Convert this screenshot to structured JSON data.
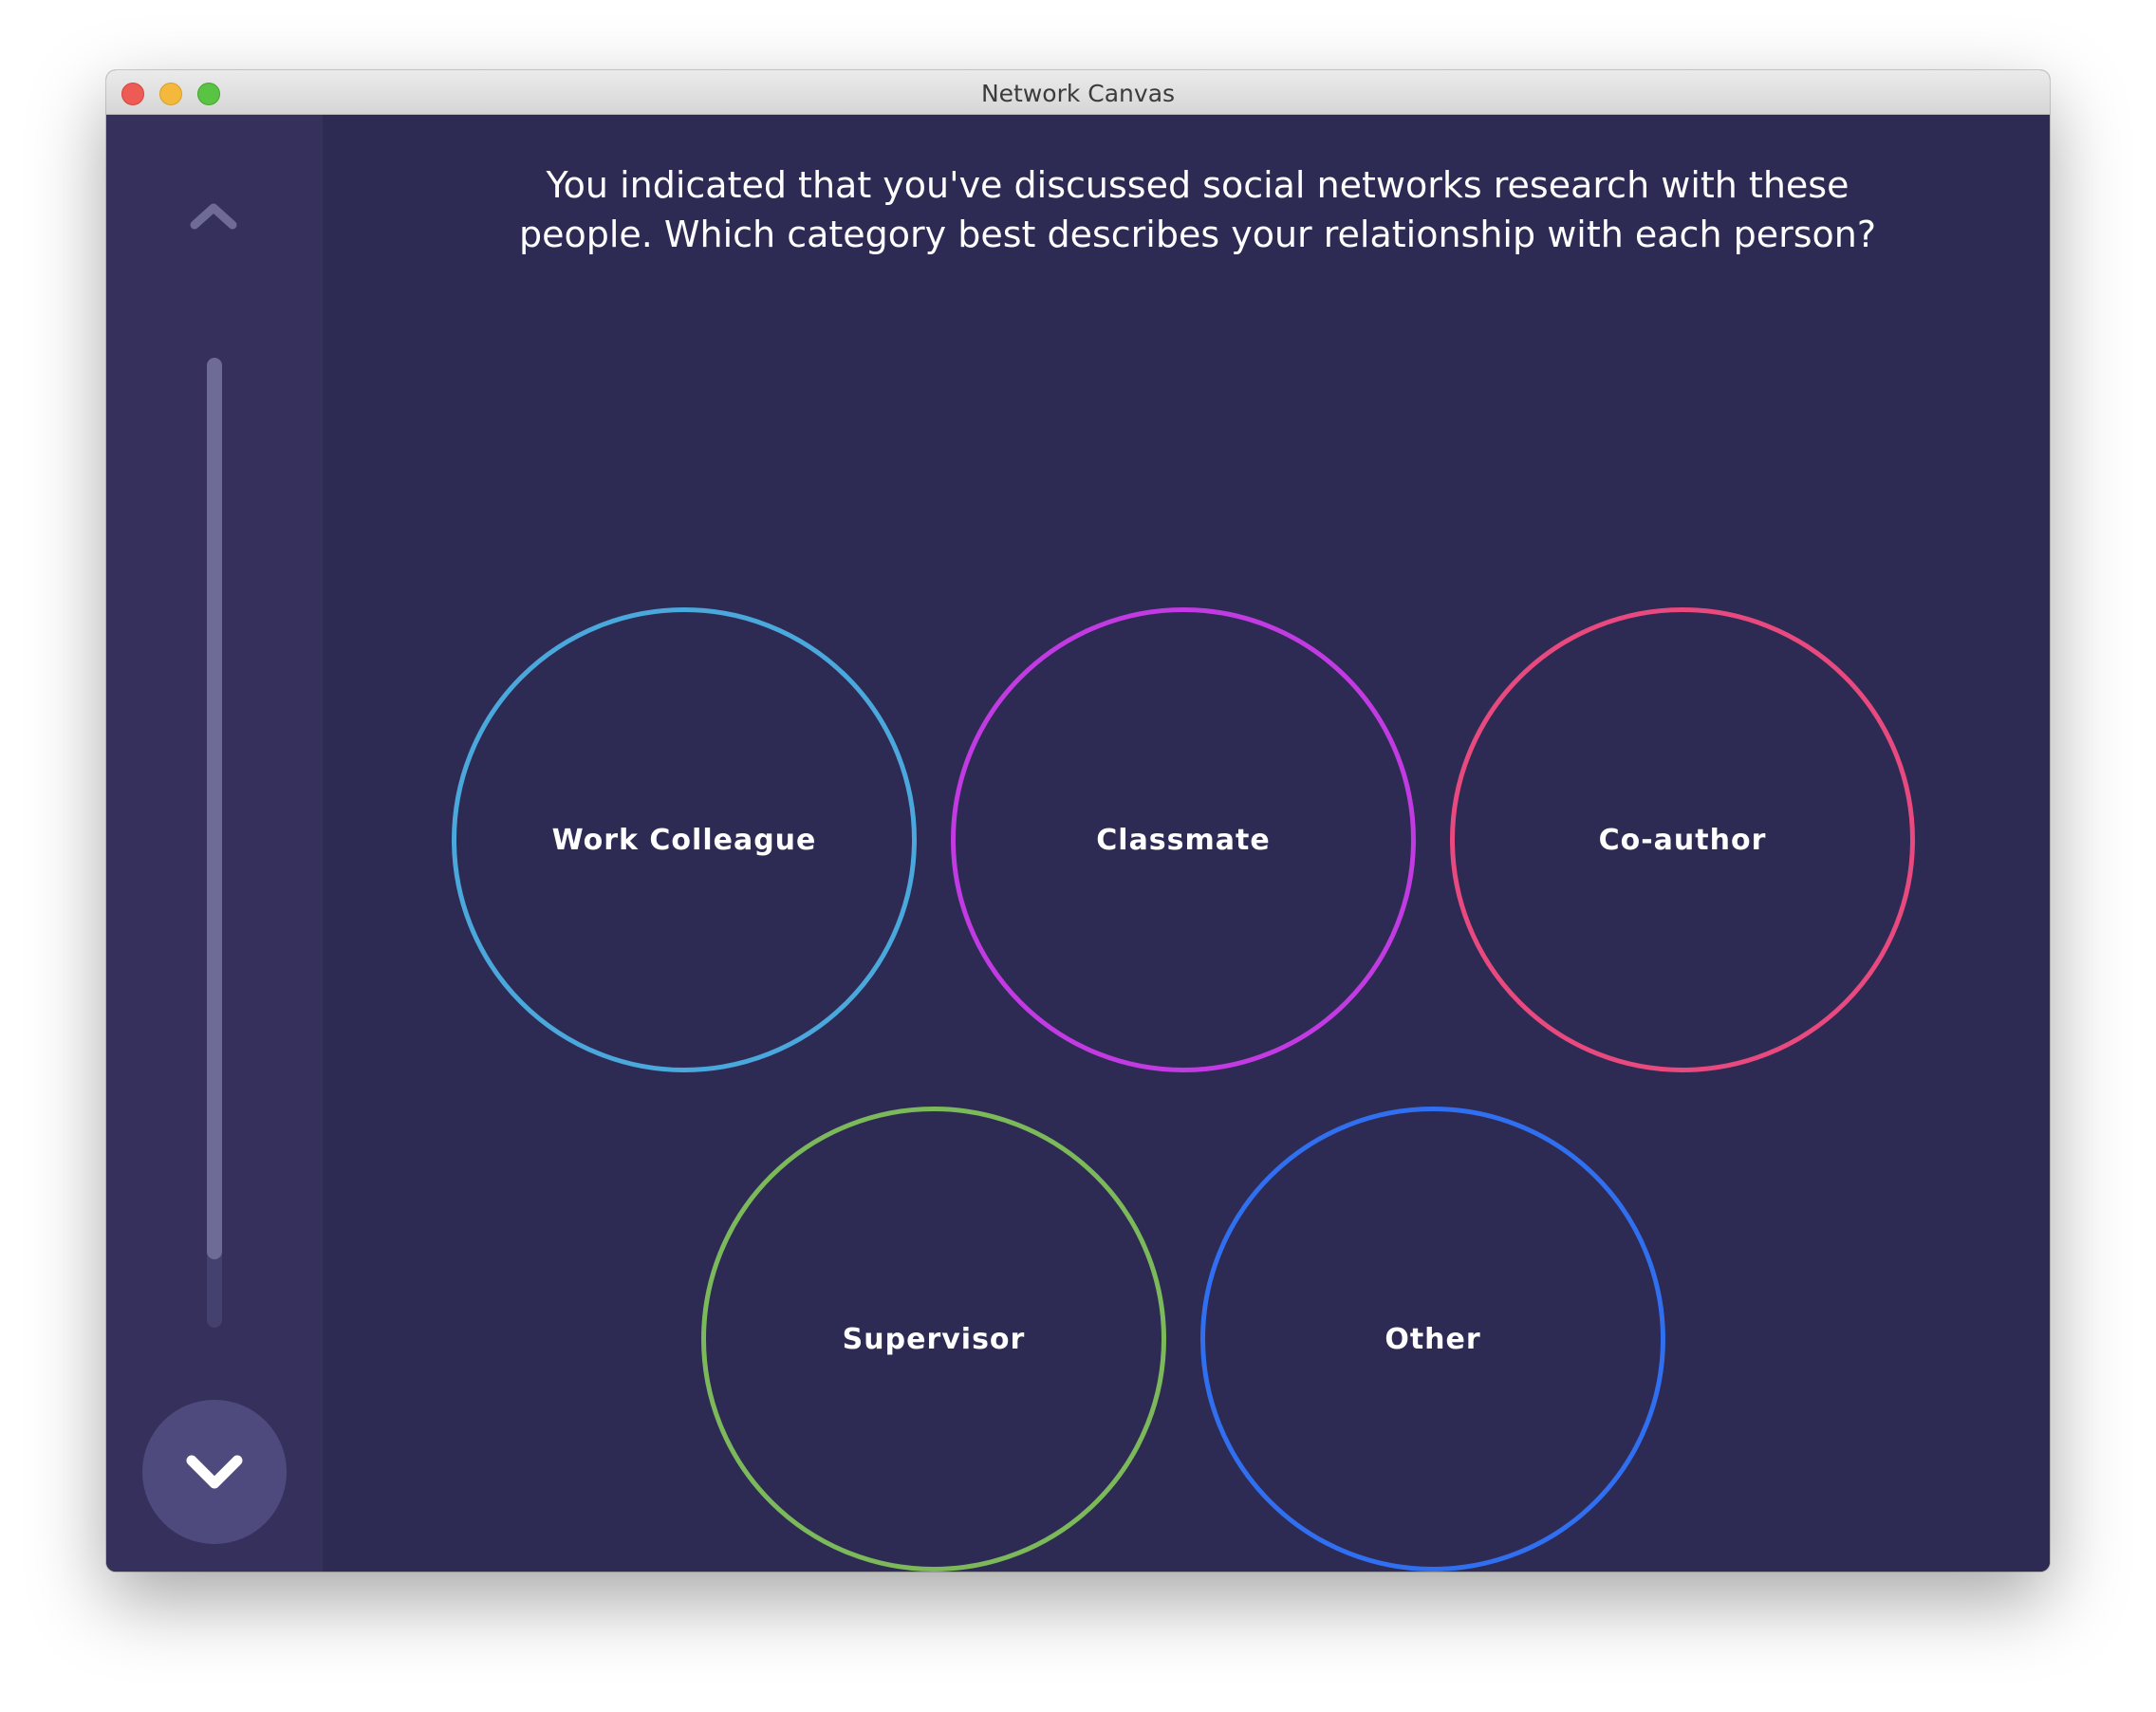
{
  "window": {
    "title": "Network Canvas"
  },
  "sidebar": {
    "up_icon": "chevron-up-icon",
    "down_icon": "chevron-down-icon",
    "progress": 0.93
  },
  "prompt": {
    "line1": "You indicated that you've discussed social networks research with these",
    "line2": "people. Which category best describes your relationship with each person?"
  },
  "categories": [
    {
      "label": "Work Colleague",
      "color": "#4aa8dc"
    },
    {
      "label": "Classmate",
      "color": "#c23ae2"
    },
    {
      "label": "Co-author",
      "color": "#e8497f"
    },
    {
      "label": "Supervisor",
      "color": "#7cb95a"
    },
    {
      "label": "Other",
      "color": "#2f6ff0"
    }
  ],
  "colors": {
    "background": "#2d2a53",
    "sidebar": "#35315c",
    "nav_button": "#4e4a7e",
    "progress_track": "#45416e",
    "progress_fill": "#6e6b96"
  }
}
